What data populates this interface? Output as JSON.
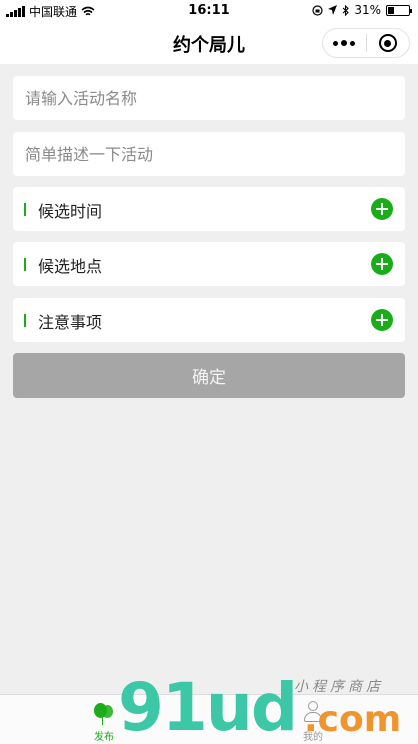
{
  "status_bar": {
    "carrier": "中国联通",
    "time": "16:11",
    "battery_text": "31%",
    "battery_level": 0.31
  },
  "nav": {
    "title": "约个局儿"
  },
  "form": {
    "name_placeholder": "请输入活动名称",
    "desc_placeholder": "简单描述一下活动",
    "rows": [
      {
        "label": "候选时间"
      },
      {
        "label": "候选地点"
      },
      {
        "label": "注意事项"
      }
    ],
    "confirm_label": "确定"
  },
  "tabs": [
    {
      "label": "发布",
      "icon": "balloon-icon",
      "active": true
    },
    {
      "label": "我的",
      "icon": "person-icon",
      "active": false
    }
  ],
  "watermark": {
    "brand": "91ud",
    "domain": ".com",
    "subtitle": "小程序商店"
  },
  "colors": {
    "accent": "#1aad19",
    "button_disabled": "#a6a6a6",
    "background": "#efefef"
  }
}
